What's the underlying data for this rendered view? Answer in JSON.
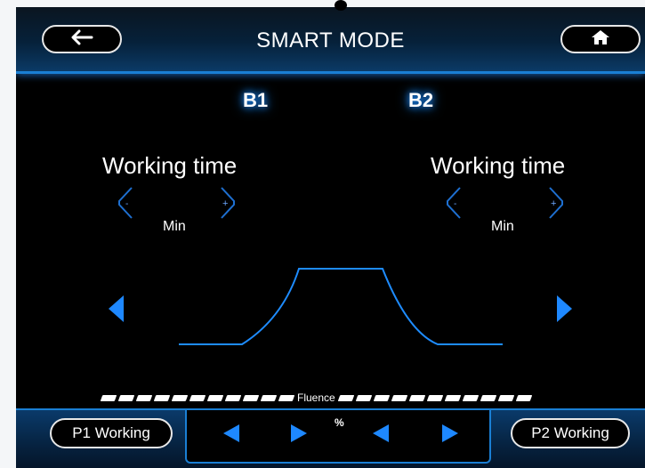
{
  "header": {
    "title": "SMART MODE",
    "back_icon": "arrow-left-icon",
    "home_icon": "home-icon"
  },
  "channels": {
    "b1": "B1",
    "b2": "B2"
  },
  "left_panel": {
    "label": "Working time",
    "unit": "Min",
    "minus": "-",
    "plus": "+"
  },
  "right_panel": {
    "label": "Working time",
    "unit": "Min",
    "minus": "-",
    "plus": "+"
  },
  "fluence": {
    "label": "Fluence",
    "unit": "%"
  },
  "footer": {
    "p1_label": "P1 Working",
    "p2_label": "P2 Working"
  },
  "colors": {
    "accent": "#1a7fd4",
    "glow": "#1c8cff",
    "arrow": "#1e88ff"
  }
}
